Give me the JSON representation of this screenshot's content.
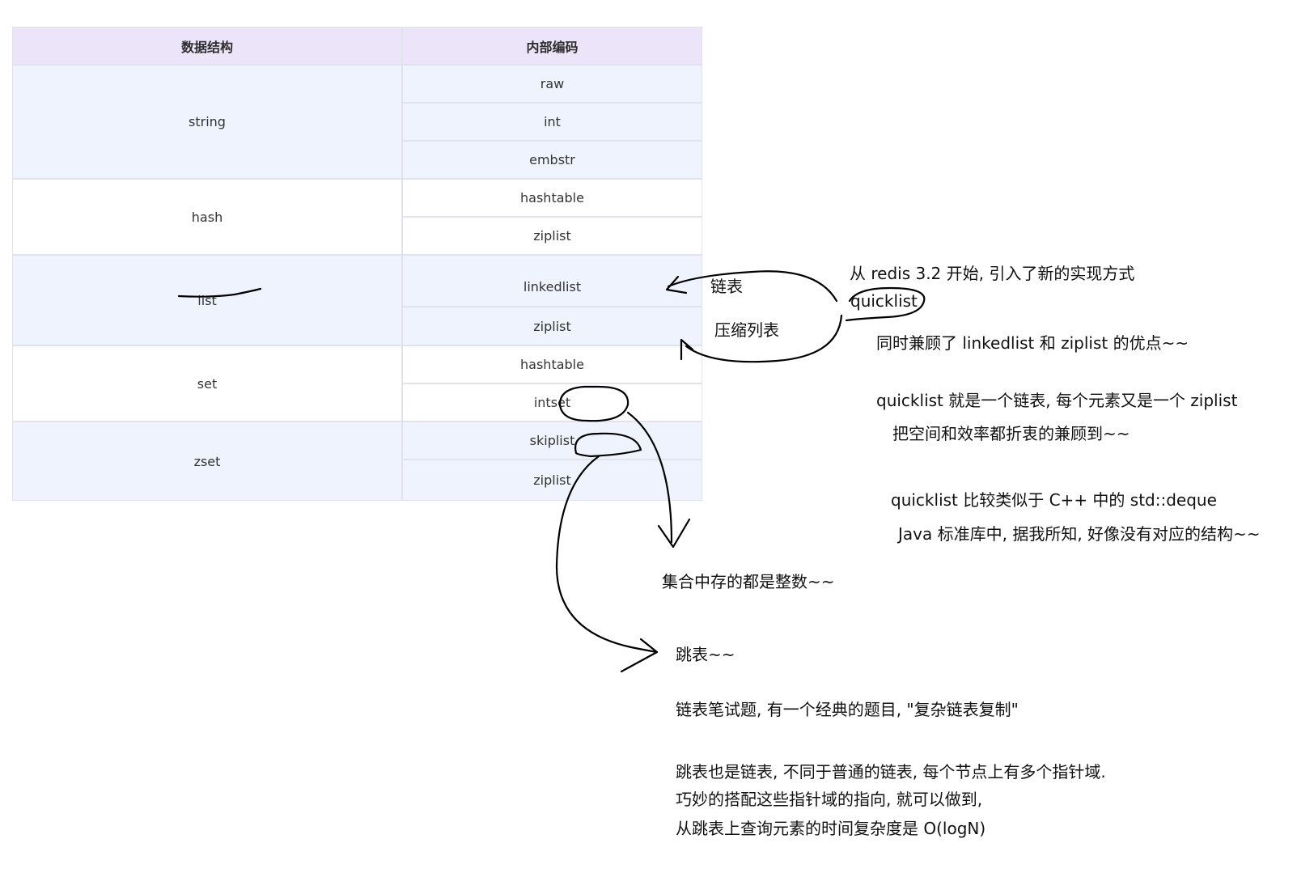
{
  "table": {
    "headers": [
      "数据结构",
      "内部编码"
    ],
    "types": [
      "string",
      "hash",
      "list",
      "set",
      "zset"
    ],
    "encodings": {
      "string": [
        "raw",
        "int",
        "embstr"
      ],
      "hash": [
        "hashtable",
        "ziplist"
      ],
      "list": [
        "linkedlist",
        "ziplist"
      ],
      "set": [
        "hashtable",
        "intset"
      ],
      "zset": [
        "skiplist",
        "ziplist"
      ]
    }
  },
  "annotations": {
    "linked_list_cn": "链表",
    "ziplist_cn": "压缩列表",
    "quicklist_intro": "从 redis 3.2 开始, 引入了新的实现方式",
    "quicklist_word": "quicklist",
    "quicklist_benefit": "同时兼顾了 linkedlist 和 ziplist 的优点~~",
    "quicklist_def": "quicklist 就是一个链表, 每个元素又是一个 ziplist",
    "quicklist_balance": "把空间和效率都折衷的兼顾到~~",
    "quicklist_cpp": "quicklist 比较类似于 C++ 中的 std::deque",
    "quicklist_java": "Java 标准库中, 据我所知, 好像没有对应的结构~~",
    "intset_note": "集合中存的都是整数~~",
    "skiplist_title": "跳表~~",
    "skiplist_interview": "链表笔试题, 有一个经典的题目, \"复杂链表复制\"",
    "skiplist_line1": "跳表也是链表, 不同于普通的链表, 每个节点上有多个指针域.",
    "skiplist_line2": "巧妙的搭配这些指针域的指向, 就可以做到,",
    "skiplist_line3": "从跳表上查询元素的时间复杂度是 O(logN)"
  },
  "colors": {
    "header_bg": "#ece5fa",
    "shaded_row_bg": "#eff3fd",
    "ink": "#000000"
  }
}
